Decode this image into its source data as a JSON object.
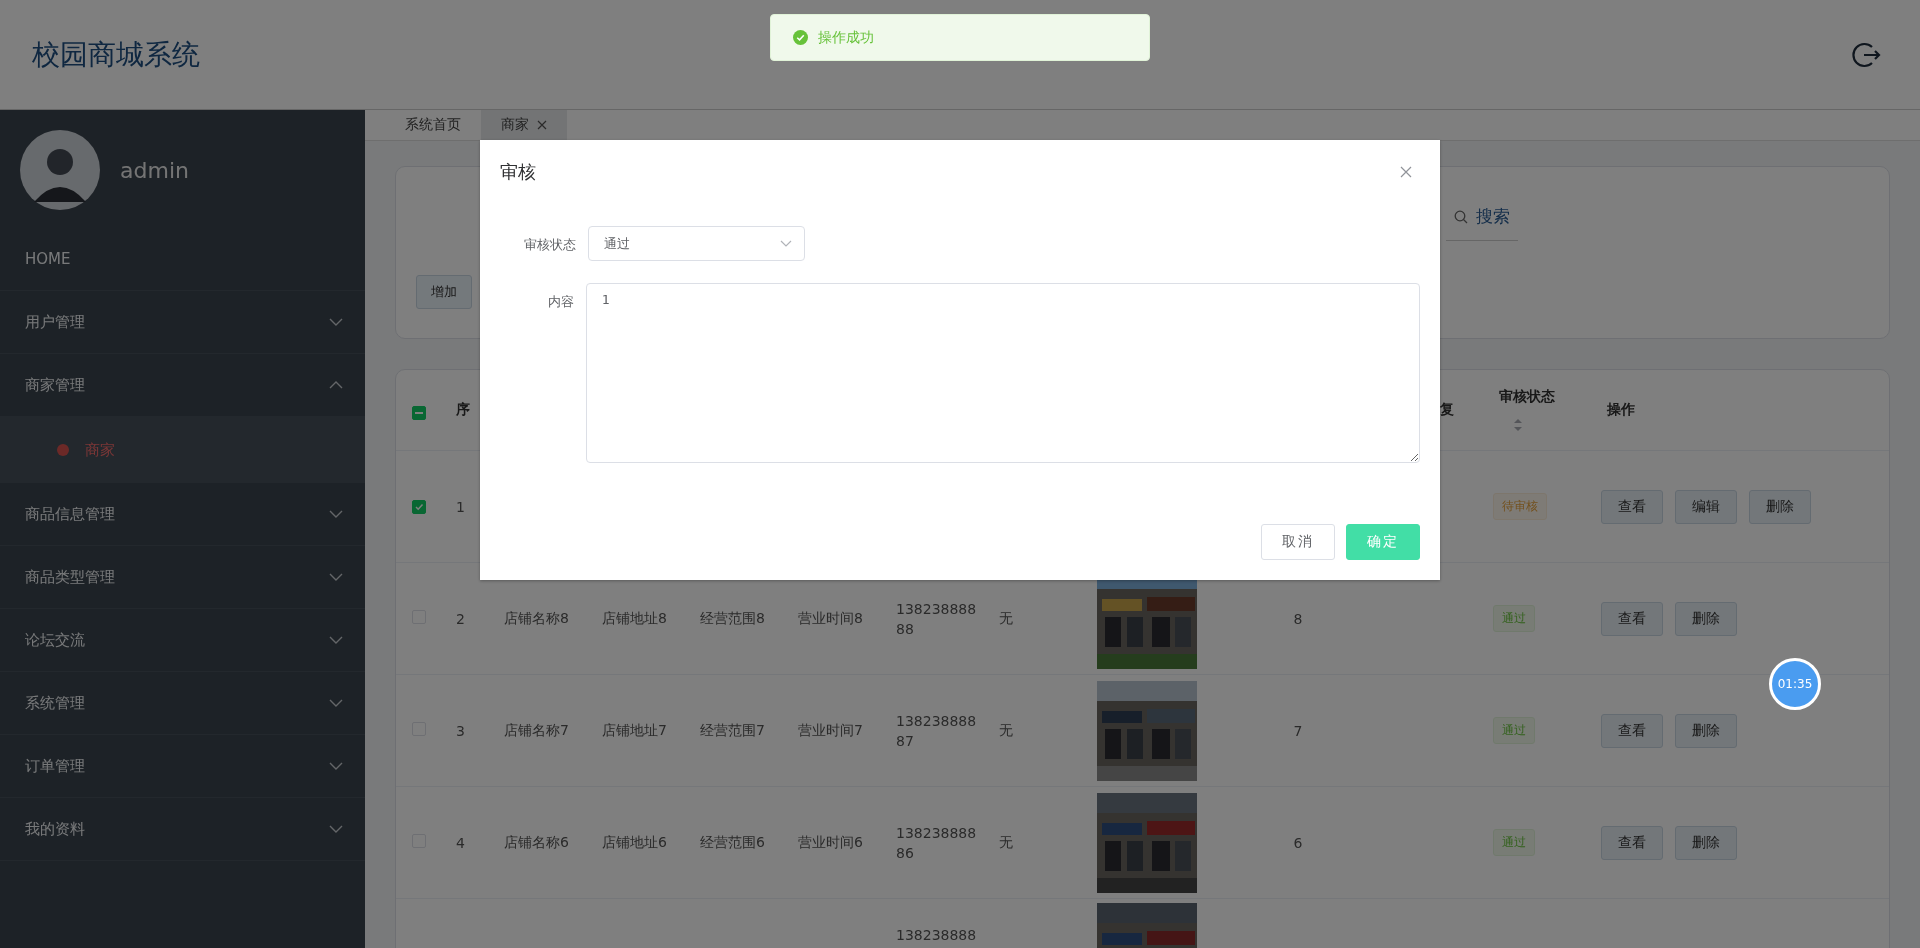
{
  "header": {
    "title": "校园商城系统"
  },
  "toast": {
    "message": "操作成功"
  },
  "user": {
    "name": "admin"
  },
  "menu": [
    {
      "label": "HOME",
      "kind": "link"
    },
    {
      "label": "用户管理",
      "kind": "submenu",
      "expanded": false
    },
    {
      "label": "商家管理",
      "kind": "submenu",
      "expanded": true,
      "children": [
        {
          "label": "商家",
          "selected": true
        }
      ]
    },
    {
      "label": "商品信息管理",
      "kind": "submenu",
      "expanded": false
    },
    {
      "label": "商品类型管理",
      "kind": "submenu",
      "expanded": false
    },
    {
      "label": "论坛交流",
      "kind": "submenu",
      "expanded": false
    },
    {
      "label": "系统管理",
      "kind": "submenu",
      "expanded": false
    },
    {
      "label": "订单管理",
      "kind": "submenu",
      "expanded": false
    },
    {
      "label": "我的资料",
      "kind": "submenu",
      "expanded": false
    }
  ],
  "tabs": [
    {
      "label": "系统首页",
      "selected": false,
      "closable": false
    },
    {
      "label": "商家",
      "selected": true,
      "closable": true
    }
  ],
  "search": {
    "button": "搜索",
    "add_button": "增加"
  },
  "table": {
    "select_all_indeterminate": true,
    "columns": [
      {
        "label": "序"
      },
      {
        "label": "复"
      },
      {
        "label": "审核状态",
        "sortable": true
      },
      {
        "label": "操作"
      }
    ],
    "rows": [
      {
        "checked": true,
        "index": "1",
        "status": {
          "label": "待审核",
          "kind": "pending"
        },
        "actions": [
          "查看",
          "编辑",
          "删除"
        ]
      },
      {
        "checked": false,
        "index": "2",
        "name": "店铺名称8",
        "address": "店铺地址8",
        "scope": "经营范围8",
        "hours": "营业时间8",
        "phone": "13823888888",
        "note": "无",
        "image": {
          "kind": "picture"
        },
        "count": "8",
        "status": {
          "label": "通过",
          "kind": "approved"
        },
        "actions": [
          "查看",
          "删除"
        ]
      },
      {
        "checked": false,
        "index": "3",
        "name": "店铺名称7",
        "address": "店铺地址7",
        "scope": "经营范围7",
        "hours": "营业时间7",
        "phone": "13823888887",
        "note": "无",
        "image": {
          "kind": "picture"
        },
        "count": "7",
        "status": {
          "label": "通过",
          "kind": "approved"
        },
        "actions": [
          "查看",
          "删除"
        ]
      },
      {
        "checked": false,
        "index": "4",
        "name": "店铺名称6",
        "address": "店铺地址6",
        "scope": "经营范围6",
        "hours": "营业时间6",
        "phone": "13823888886",
        "note": "无",
        "image": {
          "kind": "picture"
        },
        "count": "6",
        "status": {
          "label": "通过",
          "kind": "approved"
        },
        "actions": [
          "查看",
          "删除"
        ]
      },
      {
        "phone": "138238888",
        "image": {
          "kind": "picture"
        }
      }
    ]
  },
  "dialog": {
    "title": "审核",
    "fields": [
      {
        "label": "审核状态",
        "kind": "select",
        "value": "通过"
      },
      {
        "label": "内容",
        "kind": "textarea",
        "value": "1"
      }
    ],
    "buttons": [
      {
        "label": "取消",
        "kind": "default"
      },
      {
        "label": "确定",
        "kind": "primary"
      }
    ]
  },
  "timer": {
    "text": "01:35"
  }
}
